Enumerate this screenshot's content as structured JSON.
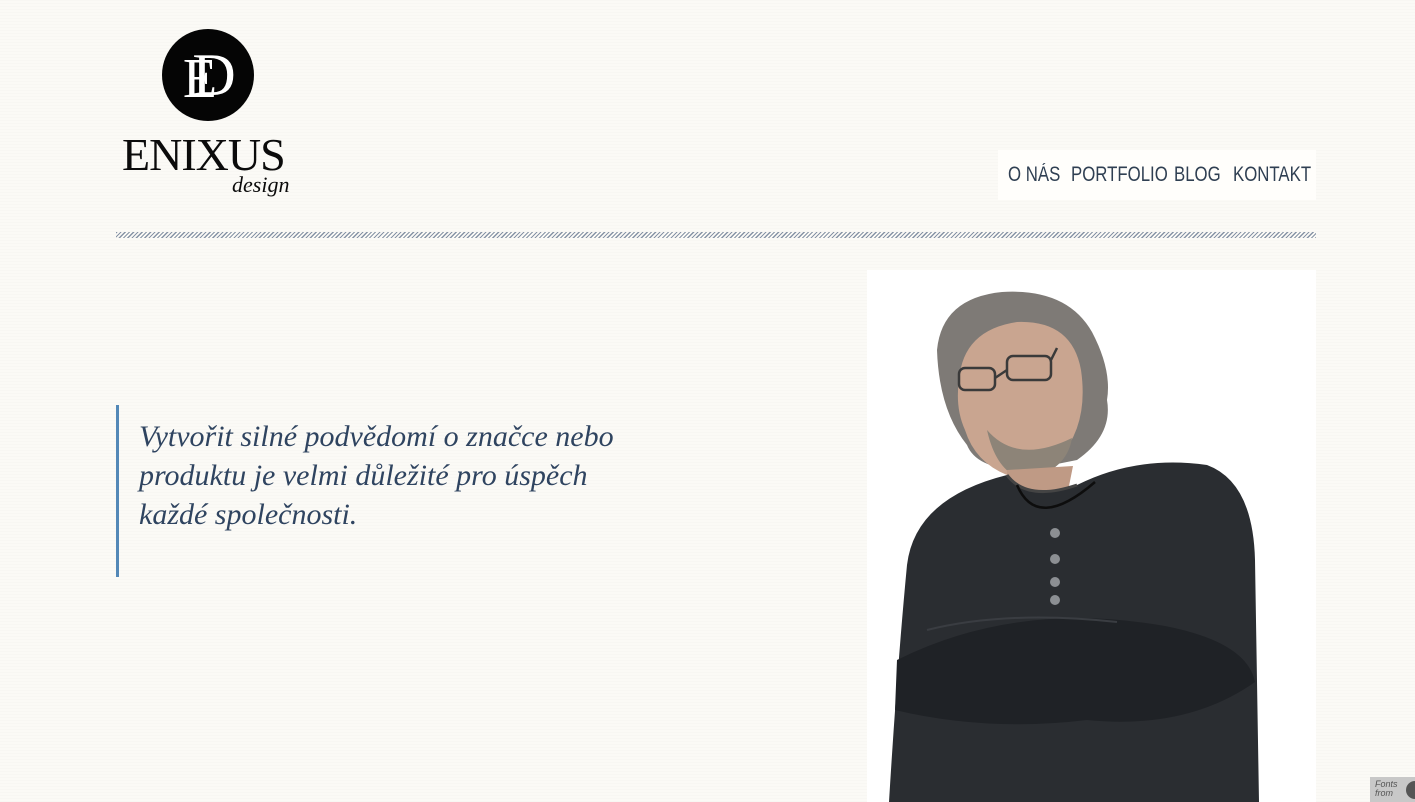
{
  "logo": {
    "monogram": "ED",
    "name": "ENIXUS",
    "tagline": "design"
  },
  "nav": {
    "items": [
      {
        "label": "O NÁS"
      },
      {
        "label": "PORTFOLIO"
      },
      {
        "label": "BLOG"
      },
      {
        "label": "KONTAKT"
      }
    ]
  },
  "quote": {
    "line1": "Vytvořit silné podvědomí o značce nebo",
    "line2": "produktu je velmi důležité pro úspěch",
    "line3": "každé společnosti."
  },
  "badge": {
    "line1": "Fonts",
    "line2": "from"
  },
  "colors": {
    "background": "#fbfaf6",
    "nav_text": "#2f3f52",
    "quote_text": "#2f4460",
    "quote_border": "#5388b7"
  }
}
